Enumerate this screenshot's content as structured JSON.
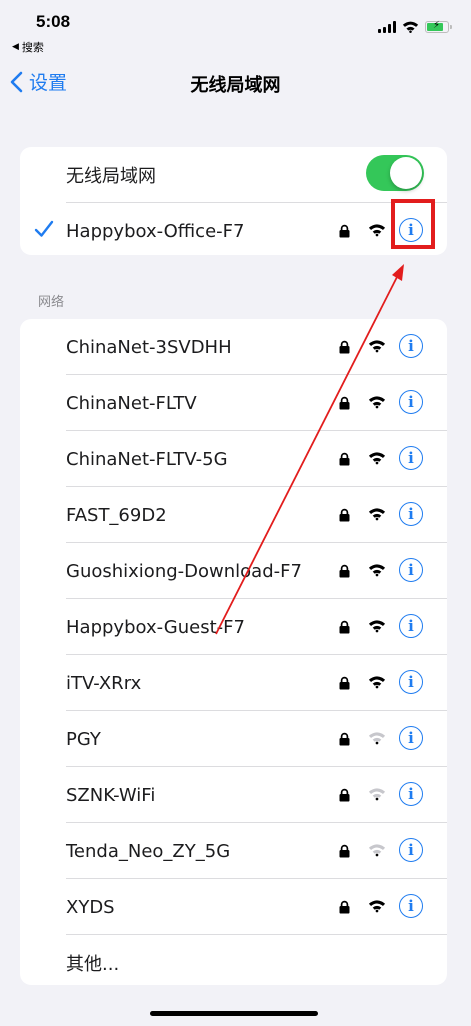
{
  "status_bar": {
    "time": "5:08",
    "back_app": "搜索"
  },
  "nav": {
    "back_label": "设置",
    "title": "无线局域网"
  },
  "wlan_toggle": {
    "label": "无线局域网",
    "on": true
  },
  "connected_network": {
    "name": "Happybox-Office-F7",
    "secured": true
  },
  "section_label": "网络",
  "networks": [
    {
      "name": "ChinaNet-3SVDHH",
      "secured": true,
      "signal": 3
    },
    {
      "name": "ChinaNet-FLTV",
      "secured": true,
      "signal": 3
    },
    {
      "name": "ChinaNet-FLTV-5G",
      "secured": true,
      "signal": 3
    },
    {
      "name": "FAST_69D2",
      "secured": true,
      "signal": 3
    },
    {
      "name": "Guoshixiong-Download-F7",
      "secured": true,
      "signal": 3
    },
    {
      "name": "Happybox-Guest-F7",
      "secured": true,
      "signal": 3
    },
    {
      "name": "iTV-XRrx",
      "secured": true,
      "signal": 3
    },
    {
      "name": "PGY",
      "secured": true,
      "signal": 1
    },
    {
      "name": "SZNK-WiFi",
      "secured": true,
      "signal": 1
    },
    {
      "name": "Tenda_Neo_ZY_5G",
      "secured": true,
      "signal": 1
    },
    {
      "name": "XYDS",
      "secured": true,
      "signal": 3
    }
  ],
  "other_label": "其他...",
  "colors": {
    "accent": "#1f7cf0",
    "toggle_on": "#34c759",
    "annotation": "#e21d1d"
  },
  "icons": {
    "info": "i"
  }
}
